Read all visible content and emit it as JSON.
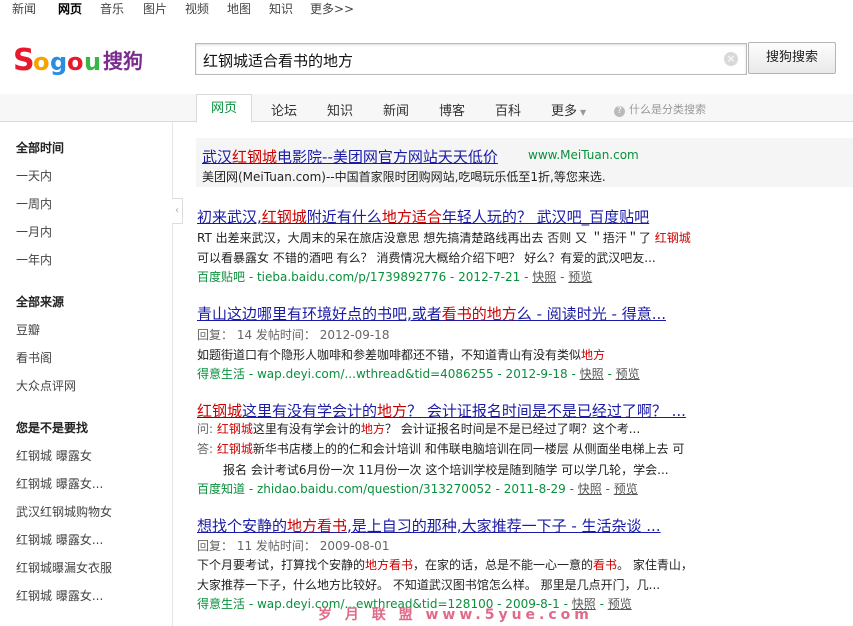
{
  "topnav": [
    "新闻",
    "网页",
    "音乐",
    "图片",
    "视频",
    "地图",
    "知识",
    "更多>>"
  ],
  "search": {
    "query": "红钢城适合看书的地方",
    "button": "搜狗搜索"
  },
  "tabs": [
    "网页",
    "论坛",
    "知识",
    "新闻",
    "博客",
    "百科",
    "更多"
  ],
  "tab_help": "什么是分类搜索",
  "sidebar": {
    "time_header": "全部时间",
    "time_items": [
      "一天内",
      "一周内",
      "一月内",
      "一年内"
    ],
    "source_header": "全部来源",
    "source_items": [
      "豆瓣",
      "看书阁",
      "大众点评网"
    ],
    "suggest_header": "您是不是要找",
    "suggest_items": [
      "红钢城 曝露女",
      "红钢城 曝露女...",
      "武汉红钢城购物女",
      "红钢城 曝露女...",
      "红钢城曝漏女衣服",
      "红钢城 曝露女..."
    ]
  },
  "ad": {
    "title_a": "武汉",
    "title_b": "红钢城",
    "title_c": "电影院--美团网官方网站天天低价",
    "domain": "www.MeiTuan.com",
    "desc": "美团网(MeiTuan.com)--中国首家限时团购网站,吃喝玩乐低至1折,等您来选."
  },
  "results": {
    "r1": {
      "t_a": "初来武汉,",
      "t_b": "红钢城",
      "t_c": "附近有什么",
      "t_d": "地方适合",
      "t_e": "年轻人玩的？ 武汉吧_百度贴吧",
      "l1": "RT 出差来武汉，大周末的呆在旅店没意思  想先搞清楚路线再出去  否则 又 ＂捂汗＂了  ",
      "l1e": "红钢城",
      "l2": "可以看暴露女  不错的酒吧  有么？  消费情况大概给介绍下吧？  好么？有爱的武汉吧友...",
      "src": "百度贴吧",
      "url": " - tieba.baidu.com/p/1739892776 - 2012-7-21 - ",
      "cache": "快照",
      "sep": " - ",
      "pre": "预览"
    },
    "r2": {
      "t_a": "青山这边哪里有环境好点的书吧,或者",
      "t_b": "看书的地方",
      "t_c": "么 - 阅读时光 - 得意...",
      "meta": "回复：  14      发帖时间：  2012-09-18",
      "l1": "如题街道口有个隐形人咖啡和参差咖啡都还不错，不知道青山有没有类似",
      "l1e": "地方",
      "src": "得意生活",
      "url": " - wap.deyi.com/...wthread&tid=4086255 - 2012-9-18 - ",
      "cache": "快照",
      "sep": " - ",
      "pre": "预览"
    },
    "r3": {
      "t_a": "红钢城",
      "t_b": "这里有没有学会计的",
      "t_c": "地方",
      "t_d": "？ 会计证报名时间是不是已经过了啊？ ...",
      "q1": "问: ",
      "q1e": "红钢城",
      "q1b": "这里有没有学会计的",
      "q1e2": "地方",
      "q1c": "？ 会计证报名时间是不是已经过了啊？这个考...",
      "a1": "答: ",
      "a1e": "红钢城",
      "a1b": "新华书店楼上的的仁和会计培训  和伟联电脑培训在同一楼层  从侧面坐电梯上去  可",
      "a2": "报名  会计考试6月份一次  11月份一次  这个培训学校是随到随学  可以学几轮，学会...",
      "src": "百度知道",
      "url": " - zhidao.baidu.com/question/313270052 - 2011-8-29 - ",
      "cache": "快照",
      "sep": " - ",
      "pre": "预览"
    },
    "r4": {
      "t_a": "想找个安静的",
      "t_b": "地方看书",
      "t_c": ",是上自习的那种,大家推荐一下子 - 生活杂谈 ...",
      "meta": "回复：  11      发帖时间：  2009-08-01",
      "l1a": "下个月要考试，打算找个安静的",
      "l1e": "地方看书",
      "l1b": "，在家的话，总是不能一心一意的",
      "l1e2": "看书",
      "l1c": "。 家住青山，",
      "l2": "大家推荐一下子，什么地方比较好。 不知道武汉图书馆怎么样。  那里是几点开门，几...",
      "src": "得意生活",
      "url": " - wap.deyi.com/...ewthread&tid=128100 - 2009-8-1 - ",
      "cache": "快照",
      "sep": " - ",
      "pre": "预览"
    }
  },
  "watermark": "岁 月 联 盟  www.5yue.com",
  "colors": {
    "title": "#1a1aa6",
    "highlight": "#cc0000",
    "url": "#0a8f3c"
  }
}
